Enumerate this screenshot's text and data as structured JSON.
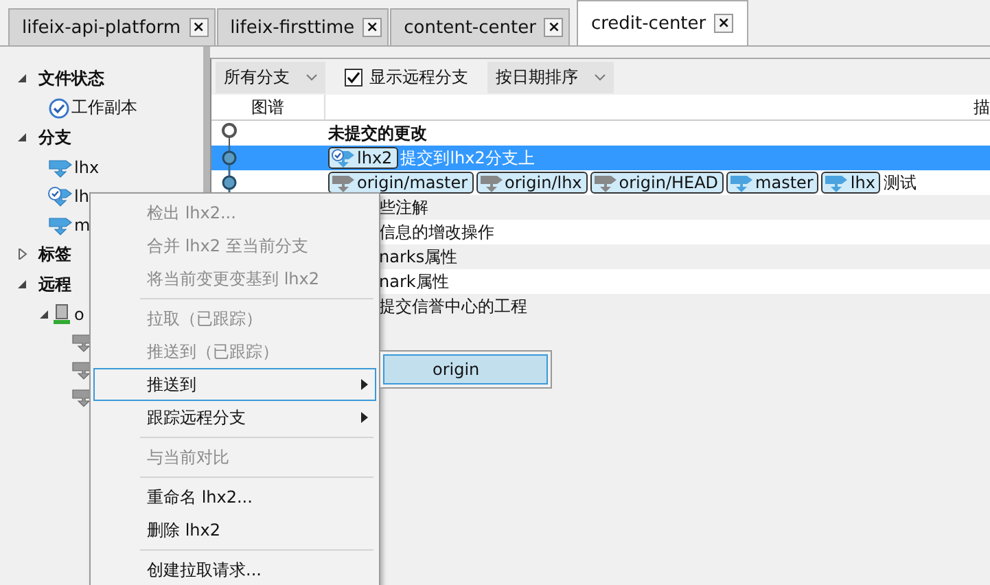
{
  "tabs": [
    {
      "label": "lifeix-api-platform",
      "close": "×",
      "selected": false
    },
    {
      "label": "lifeix-firsttime",
      "close": "×",
      "selected": false
    },
    {
      "label": "content-center",
      "close": "×",
      "selected": false
    },
    {
      "label": "credit-center",
      "close": "×",
      "selected": true
    }
  ],
  "sidebar": {
    "sections": [
      {
        "label": "文件状态",
        "expanded": true,
        "children": [
          {
            "label": "工作副本",
            "kind": "working"
          }
        ]
      },
      {
        "label": "分支",
        "expanded": true,
        "children": [
          {
            "label": "lhx",
            "kind": "branch"
          },
          {
            "label": "lh",
            "kind": "current"
          },
          {
            "label": "m",
            "kind": "branch"
          }
        ]
      },
      {
        "label": "标签",
        "expanded": false
      },
      {
        "label": "远程",
        "expanded": true,
        "children": [
          {
            "label": "o",
            "kind": "server",
            "expanded": true,
            "children": [
              {
                "kind": "remote"
              },
              {
                "kind": "remote"
              },
              {
                "kind": "remote"
              }
            ]
          }
        ]
      }
    ]
  },
  "toolbar": {
    "branch_filter": "所有分支",
    "show_remote": {
      "label": "显示远程分支",
      "checked": true
    },
    "sort": "按日期排序"
  },
  "table": {
    "columns": [
      "图谱",
      "描"
    ],
    "rows": [
      {
        "kind": "uncommitted",
        "selected": false,
        "refs": [],
        "text": "未提交的更改"
      },
      {
        "kind": "commit",
        "selected": true,
        "refs": [
          {
            "label": "lhx2",
            "kind": "current"
          }
        ],
        "text": "提交到lhx2分支上"
      },
      {
        "kind": "commit",
        "selected": false,
        "refs": [
          {
            "label": "origin/master",
            "kind": "remote"
          },
          {
            "label": "origin/lhx",
            "kind": "remote"
          },
          {
            "label": "origin/HEAD",
            "kind": "remote"
          },
          {
            "label": "master",
            "kind": "branch"
          },
          {
            "label": "lhx",
            "kind": "branch"
          }
        ],
        "text": "测试"
      },
      {
        "kind": "partial",
        "selected": false,
        "refs": [],
        "text": "些注解"
      },
      {
        "kind": "partial",
        "selected": false,
        "refs": [],
        "text": "信息的增改操作"
      },
      {
        "kind": "partial",
        "selected": false,
        "refs": [],
        "text": "narks属性"
      },
      {
        "kind": "partial",
        "selected": false,
        "refs": [],
        "text": "nark属性"
      },
      {
        "kind": "partial",
        "selected": false,
        "refs": [],
        "text": "提交信誉中心的工程"
      }
    ]
  },
  "context_menu": {
    "items": [
      {
        "kind": "item",
        "label": "检出 lhx2...",
        "disabled": true,
        "selected": false
      },
      {
        "kind": "item",
        "label": "合并 lhx2 至当前分支",
        "disabled": true,
        "selected": false
      },
      {
        "kind": "item",
        "label": "将当前变更变基到 lhx2",
        "disabled": true,
        "selected": false
      },
      {
        "kind": "separator"
      },
      {
        "kind": "item",
        "label": "拉取（已跟踪）",
        "disabled": true,
        "selected": false
      },
      {
        "kind": "item",
        "label": "推送到（已跟踪）",
        "disabled": true,
        "selected": false
      },
      {
        "kind": "submenu",
        "label": "推送到",
        "disabled": false,
        "selected": true
      },
      {
        "kind": "submenu",
        "label": "跟踪远程分支",
        "disabled": false,
        "selected": false
      },
      {
        "kind": "separator"
      },
      {
        "kind": "item",
        "label": "与当前对比",
        "disabled": true,
        "selected": false
      },
      {
        "kind": "separator"
      },
      {
        "kind": "item",
        "label": "重命名 lhx2...",
        "disabled": false,
        "selected": false
      },
      {
        "kind": "item",
        "label": "删除 lhx2",
        "disabled": false,
        "selected": false
      },
      {
        "kind": "separator"
      },
      {
        "kind": "item",
        "label": "创建拉取请求...",
        "disabled": false,
        "selected": false
      }
    ],
    "submenu": [
      {
        "label": "origin",
        "selected": true
      }
    ]
  }
}
